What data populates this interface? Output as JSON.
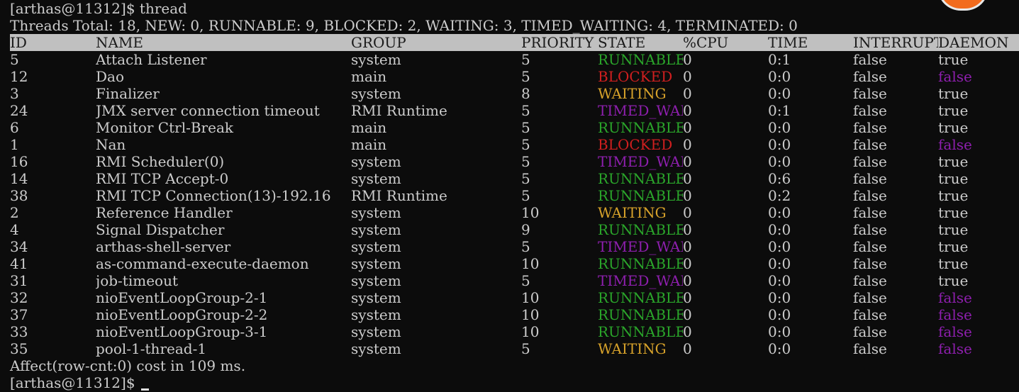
{
  "prompt_top": "[arthas@11312]$ thread",
  "summary": "Threads Total: 18, NEW: 0, RUNNABLE: 9, BLOCKED: 2, WAITING: 3, TIMED_WAITING: 4, TERMINATED: 0",
  "columns": [
    "ID",
    "NAME",
    "GROUP",
    "PRIORITY",
    "STATE",
    "%CPU",
    "TIME",
    "INTERRUPT",
    "DAEMON"
  ],
  "colors": {
    "RUNNABLE": "#2aa52a",
    "BLOCKED": "#d01f1f",
    "WAITING": "#d6a12a",
    "TIMED_WAI": "#8e1fae",
    "daemon_false": "#8e1fae",
    "default": "#cccccc"
  },
  "rows": [
    {
      "id": "5",
      "name": "Attach Listener",
      "group": "system",
      "priority": "5",
      "state": "RUNNABLE",
      "cpu": "0",
      "time": "0:1",
      "interrupt": "false",
      "daemon": "true"
    },
    {
      "id": "12",
      "name": "Dao",
      "group": "main",
      "priority": "5",
      "state": "BLOCKED",
      "cpu": "0",
      "time": "0:0",
      "interrupt": "false",
      "daemon": "false"
    },
    {
      "id": "3",
      "name": "Finalizer",
      "group": "system",
      "priority": "8",
      "state": "WAITING",
      "cpu": "0",
      "time": "0:0",
      "interrupt": "false",
      "daemon": "true"
    },
    {
      "id": "24",
      "name": "JMX server connection timeout",
      "group": "RMI Runtime",
      "priority": "5",
      "state": "TIMED_WAI",
      "cpu": "0",
      "time": "0:1",
      "interrupt": "false",
      "daemon": "true"
    },
    {
      "id": "6",
      "name": "Monitor Ctrl-Break",
      "group": "main",
      "priority": "5",
      "state": "RUNNABLE",
      "cpu": "0",
      "time": "0:0",
      "interrupt": "false",
      "daemon": "true"
    },
    {
      "id": "1",
      "name": "Nan",
      "group": "main",
      "priority": "5",
      "state": "BLOCKED",
      "cpu": "0",
      "time": "0:0",
      "interrupt": "false",
      "daemon": "false"
    },
    {
      "id": "16",
      "name": "RMI Scheduler(0)",
      "group": "system",
      "priority": "5",
      "state": "TIMED_WAI",
      "cpu": "0",
      "time": "0:0",
      "interrupt": "false",
      "daemon": "true"
    },
    {
      "id": "14",
      "name": "RMI TCP Accept-0",
      "group": "system",
      "priority": "5",
      "state": "RUNNABLE",
      "cpu": "0",
      "time": "0:6",
      "interrupt": "false",
      "daemon": "true"
    },
    {
      "id": "38",
      "name": "RMI TCP Connection(13)-192.16",
      "group": "RMI Runtime",
      "priority": "5",
      "state": "RUNNABLE",
      "cpu": "0",
      "time": "0:2",
      "interrupt": "false",
      "daemon": "true"
    },
    {
      "id": "2",
      "name": "Reference Handler",
      "group": "system",
      "priority": "10",
      "state": "WAITING",
      "cpu": "0",
      "time": "0:0",
      "interrupt": "false",
      "daemon": "true"
    },
    {
      "id": "4",
      "name": "Signal Dispatcher",
      "group": "system",
      "priority": "9",
      "state": "RUNNABLE",
      "cpu": "0",
      "time": "0:0",
      "interrupt": "false",
      "daemon": "true"
    },
    {
      "id": "34",
      "name": "arthas-shell-server",
      "group": "system",
      "priority": "5",
      "state": "TIMED_WAI",
      "cpu": "0",
      "time": "0:0",
      "interrupt": "false",
      "daemon": "true"
    },
    {
      "id": "41",
      "name": "as-command-execute-daemon",
      "group": "system",
      "priority": "10",
      "state": "RUNNABLE",
      "cpu": "0",
      "time": "0:0",
      "interrupt": "false",
      "daemon": "true"
    },
    {
      "id": "31",
      "name": "job-timeout",
      "group": "system",
      "priority": "5",
      "state": "TIMED_WAI",
      "cpu": "0",
      "time": "0:0",
      "interrupt": "false",
      "daemon": "true"
    },
    {
      "id": "32",
      "name": "nioEventLoopGroup-2-1",
      "group": "system",
      "priority": "10",
      "state": "RUNNABLE",
      "cpu": "0",
      "time": "0:0",
      "interrupt": "false",
      "daemon": "false"
    },
    {
      "id": "37",
      "name": "nioEventLoopGroup-2-2",
      "group": "system",
      "priority": "10",
      "state": "RUNNABLE",
      "cpu": "0",
      "time": "0:0",
      "interrupt": "false",
      "daemon": "false"
    },
    {
      "id": "33",
      "name": "nioEventLoopGroup-3-1",
      "group": "system",
      "priority": "10",
      "state": "RUNNABLE",
      "cpu": "0",
      "time": "0:0",
      "interrupt": "false",
      "daemon": "false"
    },
    {
      "id": "35",
      "name": "pool-1-thread-1",
      "group": "system",
      "priority": "5",
      "state": "WAITING",
      "cpu": "0",
      "time": "0:0",
      "interrupt": "false",
      "daemon": "false"
    }
  ],
  "footer": "Affect(row-cnt:0) cost in 109 ms.",
  "prompt_bottom": "[arthas@11312]$"
}
